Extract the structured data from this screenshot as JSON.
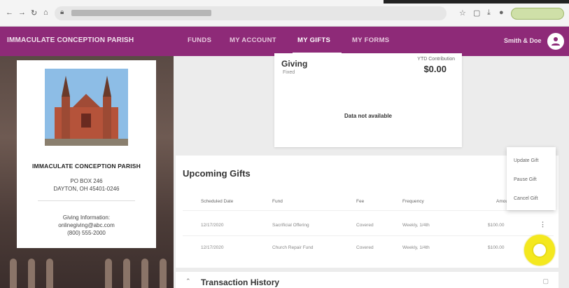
{
  "browser": {
    "url": "",
    "nav_back": "←",
    "nav_forward": "→",
    "reload": "↻",
    "home": "⌂"
  },
  "header": {
    "parish_name": "IMMACULATE CONCEPTION PARISH",
    "tabs": [
      {
        "label": "FUNDS"
      },
      {
        "label": "MY ACCOUNT"
      },
      {
        "label": "MY GIFTS"
      },
      {
        "label": "MY FORMS"
      }
    ],
    "active_tab": "MY GIFTS",
    "user_name": "Smith & Doe",
    "brand_color": "#8e2a78"
  },
  "parish_card": {
    "name": "IMMACULATE CONCEPTION PARISH",
    "address_line1": "PO BOX 246",
    "address_line2": "DAYTON, OH 45401-0246",
    "giving_label": "Giving Information:",
    "email": "onlinegiving@abc.com",
    "phone": "(800) 555-2000"
  },
  "giving_card": {
    "title": "Giving",
    "subtitle": "Fixed",
    "contribution_label": "YTD Contribution",
    "amount": "$0.00",
    "not_available": "Data not available"
  },
  "upcoming": {
    "title": "Upcoming Gifts",
    "columns": [
      "Scheduled Date",
      "Fund",
      "Fee",
      "Frequency",
      "Amount"
    ],
    "rows": [
      {
        "date": "12/17/2020",
        "fund": "Sacrificial Offering",
        "fee": "Covered",
        "frequency": "Weekly, 1/4th",
        "amount": "$100.00"
      },
      {
        "date": "12/17/2020",
        "fund": "Church Repair Fund",
        "fee": "Covered",
        "frequency": "Weekly, 1/4th",
        "amount": "$100.00"
      }
    ]
  },
  "menu": {
    "items": [
      "Update Gift",
      "Pause Gift",
      "Cancel Gift"
    ]
  },
  "transactions": {
    "title": "Transaction History"
  },
  "colors": {
    "accent": "#8e2a78",
    "highlight": "#f4e81e"
  }
}
